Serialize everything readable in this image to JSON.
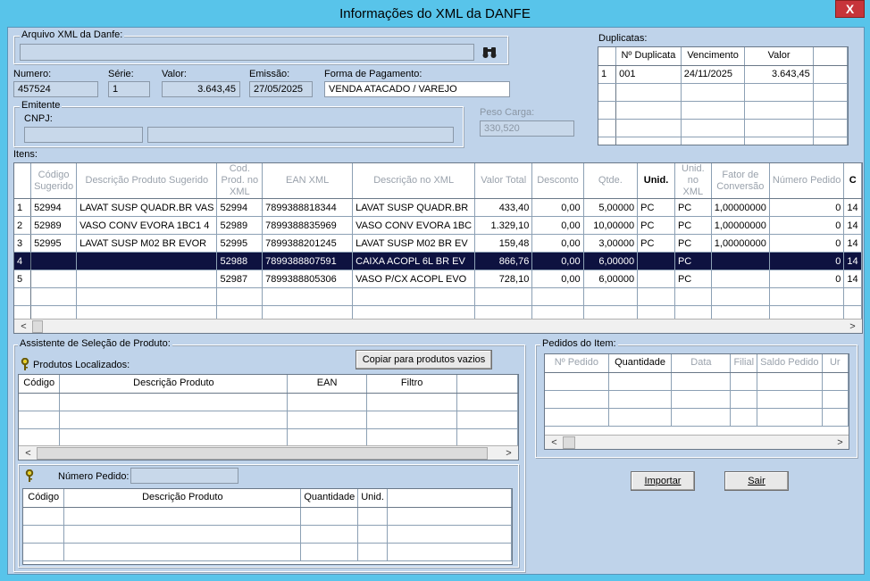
{
  "window": {
    "title": "Informações do XML da DANFE",
    "close_label": "X"
  },
  "arquivo": {
    "legend": "Arquivo XML da Danfe:",
    "value": ""
  },
  "header": {
    "numero_label": "Numero:",
    "numero": "457524",
    "serie_label": "Série:",
    "serie": "1",
    "valor_label": "Valor:",
    "valor": "3.643,45",
    "emissao_label": "Emissão:",
    "emissao": "27/05/2025",
    "forma_label": "Forma de Pagamento:",
    "forma": "VENDA ATACADO / VAREJO",
    "emitente_legend": "Emitente",
    "cnpj_label": "CNPJ:",
    "cnpj": "",
    "razao": "",
    "peso_label": "Peso Carga:",
    "peso": "330,520"
  },
  "duplicatas": {
    "label": "Duplicatas:",
    "columns": [
      "Nº Duplicata",
      "Vencimento",
      "Valor"
    ],
    "rows": [
      {
        "ind": "1",
        "num": "001",
        "venc": "24/11/2025",
        "valor": "3.643,45"
      }
    ]
  },
  "itens": {
    "label": "Itens:",
    "columns": [
      "Código Sugerido",
      "Descrição Produto Sugerido",
      "Cod. Prod. no XML",
      "EAN XML",
      "Descrição no XML",
      "Valor Total",
      "Desconto",
      "Qtde.",
      "Unid.",
      "Unid. no XML",
      "Fator de Conversão",
      "Número Pedido",
      "C"
    ],
    "rows": [
      {
        "ind": "1",
        "cod": "52994",
        "desc": "LAVAT SUSP QUADR.BR VAS",
        "codxml": "52994",
        "ean": "7899388818344",
        "descxml": "LAVAT SUSP QUADR.BR",
        "total": "433,40",
        "desconto": "0,00",
        "qtde": "5,00000",
        "unid": "PC",
        "unidxml": "PC",
        "fator": "1,00000000",
        "pedido": "0",
        "extra": "14"
      },
      {
        "ind": "2",
        "cod": "52989",
        "desc": "VASO CONV EVORA 1BC1 4",
        "codxml": "52989",
        "ean": "7899388835969",
        "descxml": "VASO CONV EVORA 1BC",
        "total": "1.329,10",
        "desconto": "0,00",
        "qtde": "10,00000",
        "unid": "PC",
        "unidxml": "PC",
        "fator": "1,00000000",
        "pedido": "0",
        "extra": "14"
      },
      {
        "ind": "3",
        "cod": "52995",
        "desc": "LAVAT SUSP M02 BR EVOR",
        "codxml": "52995",
        "ean": "7899388201245",
        "descxml": "LAVAT SUSP M02 BR EV",
        "total": "159,48",
        "desconto": "0,00",
        "qtde": "3,00000",
        "unid": "PC",
        "unidxml": "PC",
        "fator": "1,00000000",
        "pedido": "0",
        "extra": "14"
      },
      {
        "ind": "4",
        "cod": "",
        "desc": "",
        "codxml": "52988",
        "ean": "7899388807591",
        "descxml": "CAIXA ACOPL 6L BR EV",
        "total": "866,76",
        "desconto": "0,00",
        "qtde": "6,00000",
        "unid": "",
        "unidxml": "PC",
        "fator": "",
        "pedido": "0",
        "extra": "14"
      },
      {
        "ind": "5",
        "cod": "",
        "desc": "",
        "codxml": "52987",
        "ean": "7899388805306",
        "descxml": "VASO P/CX ACOPL EVO",
        "total": "728,10",
        "desconto": "0,00",
        "qtde": "6,00000",
        "unid": "",
        "unidxml": "PC",
        "fator": "",
        "pedido": "0",
        "extra": "14"
      }
    ]
  },
  "assistente": {
    "legend": "Assistente de Seleção de Produto:",
    "localizados_label": "Produtos Localizados:",
    "copiar_label": "Copiar para produtos vazios",
    "columns": [
      "Código",
      "Descrição Produto",
      "EAN",
      "Filtro"
    ],
    "numero_pedido_label": "Número Pedido:",
    "numero_pedido": "",
    "pedido_columns": [
      "Código",
      "Descrição Produto",
      "Quantidade",
      "Unid."
    ]
  },
  "pedidos": {
    "legend": "Pedidos do Item:",
    "columns": [
      "Nº Pedido",
      "Quantidade",
      "Data",
      "Filial",
      "Saldo Pedido",
      "Ur"
    ]
  },
  "buttons": {
    "importar": "Importar",
    "sair": "Sair"
  }
}
